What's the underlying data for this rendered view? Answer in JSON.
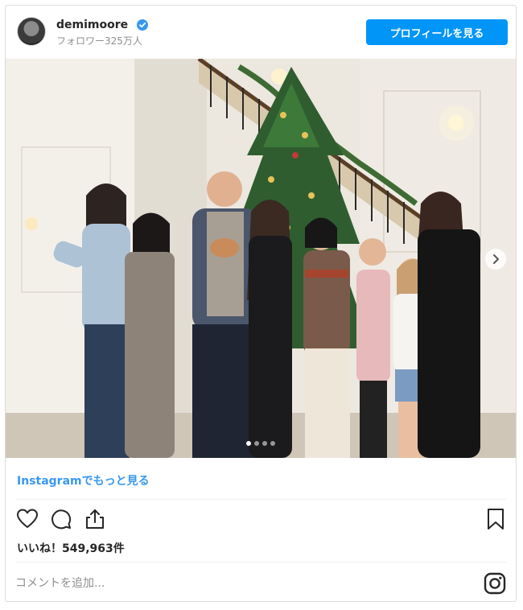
{
  "header": {
    "username": "demimoore",
    "followers": "フォロワー325万人",
    "profile_button": "プロフィールを見る"
  },
  "photo": {
    "carousel_dots": 4,
    "active_dot": 0
  },
  "links": {
    "more_on_instagram": "Instagramでもっと見る"
  },
  "actions": {
    "like_icon": "heart-icon",
    "comment_icon": "comment-icon",
    "share_icon": "share-icon",
    "save_icon": "bookmark-icon"
  },
  "likes": {
    "text": "いいね！549,963件"
  },
  "comment": {
    "placeholder": "コメントを追加..."
  },
  "colors": {
    "accent": "#0095f6",
    "link": "#3897f0"
  }
}
